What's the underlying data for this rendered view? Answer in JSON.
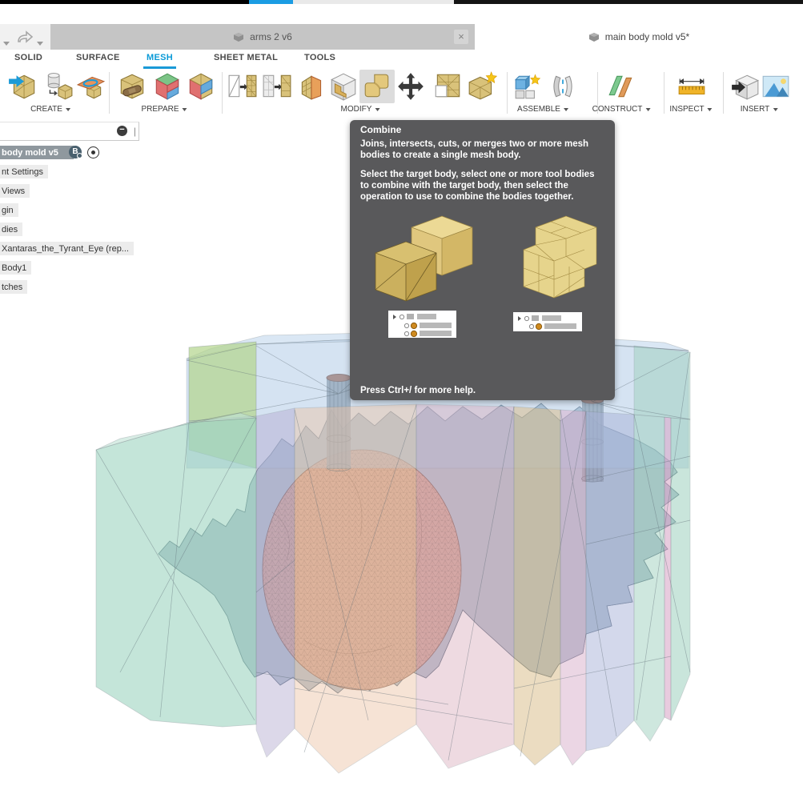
{
  "titlebar": {
    "strip_segments": [
      {
        "color": "#000000",
        "from": 0,
        "to": 311
      },
      {
        "color": "#1b9ce3",
        "from": 311,
        "to": 366
      },
      {
        "color": "#e9e9e9",
        "from": 366,
        "to": 567
      },
      {
        "color": "#141414",
        "from": 567,
        "to": 1003
      }
    ]
  },
  "document_tabs": {
    "inactive": {
      "label": "arms 2 v6",
      "close_label": "×"
    },
    "active": {
      "label": "main body mold v5*"
    }
  },
  "ribbon": {
    "tabs": [
      "SOLID",
      "SURFACE",
      "MESH",
      "SHEET METAL",
      "TOOLS"
    ],
    "active_tab": "MESH",
    "groups": [
      "CREATE",
      "PREPARE",
      "MODIFY",
      "ASSEMBLE",
      "CONSTRUCT",
      "INSPECT",
      "INSERT"
    ]
  },
  "browser": {
    "items": [
      {
        "label": "body mold v5",
        "selected": true
      },
      {
        "label": "nt Settings"
      },
      {
        "label": "Views"
      },
      {
        "label": "gin"
      },
      {
        "label": "dies"
      },
      {
        "label": "Xantaras_the_Tyrant_Eye (rep..."
      },
      {
        "label": "Body1"
      },
      {
        "label": "tches"
      }
    ],
    "active_doc_badge": "B",
    "collapse_glyph": "−",
    "cursor_glyph": "|"
  },
  "tooltip": {
    "title": "Combine",
    "para1": "Joins, intersects, cuts, or merges two or more mesh bodies to create a single mesh body.",
    "para2": "Select the target body, select one or more tool bodies to combine with the target body, then select the operation to use to combine the bodies together.",
    "footer": "Press Ctrl+/ for more help."
  },
  "colors": {
    "accent_blue": "#0a9ad7",
    "tooltip_bg": "#59595b",
    "tab_inactive_bg": "#c5c5c5",
    "combine_highlight": "#dcdcdc",
    "mold_green": "#b5d68f",
    "mold_teal": "#9ed4c0",
    "mold_blue_slab": "#a9c6e4",
    "mold_purple": "#b3a9cf",
    "mold_salmon": "#ecc3a4",
    "mold_rose": "#d9a9b9",
    "mold_tan": "#d9bb85",
    "mold_violet": "#d9aecb",
    "mold_lavender": "#a9b2d8",
    "mesh_body": "#aebfcc",
    "mesh_sphere": "#d4a795",
    "sprue_cap": "#a96a50",
    "tooltip_cube_tan": "#e3c87c"
  }
}
